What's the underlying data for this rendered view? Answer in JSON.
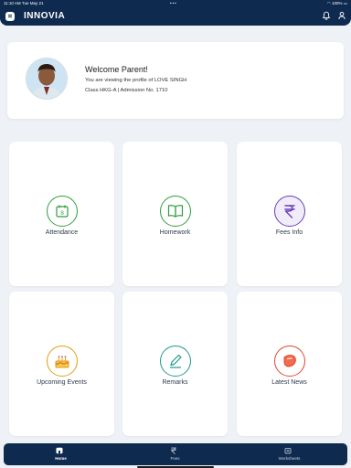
{
  "status_bar": {
    "time": "11:10 AM",
    "date": "Tue May 21",
    "dots": "•••",
    "battery": "100%"
  },
  "header": {
    "title": "INNOVIA",
    "menu_icon": "menu-icon",
    "bell_icon": "bell-icon",
    "user_icon": "user-icon"
  },
  "profile": {
    "welcome": "Welcome Parent!",
    "viewing": "You are viewing the profile of LOVE SINGH",
    "class_info": "Class HKG-A | Admission No. 1710"
  },
  "tiles": [
    {
      "label": "Attendance",
      "icon": "calendar-icon",
      "color": "#2e9e3e"
    },
    {
      "label": "Homework",
      "icon": "book-icon",
      "color": "#2e9e3e"
    },
    {
      "label": "Fees Info",
      "icon": "rupee-icon",
      "color": "#6a3fb5"
    },
    {
      "label": "Upcoming Events",
      "icon": "cake-icon",
      "color": "#e0a010"
    },
    {
      "label": "Remarks",
      "icon": "pen-icon",
      "color": "#1f9a8a"
    },
    {
      "label": "Latest News",
      "icon": "news-icon",
      "color": "#e0462e"
    }
  ],
  "bottom_nav": [
    {
      "label": "Home",
      "icon": "home-icon",
      "active": true
    },
    {
      "label": "Fees",
      "icon": "rupee-icon",
      "active": false
    },
    {
      "label": "Worksheets",
      "icon": "worksheet-icon",
      "active": false
    }
  ],
  "colors": {
    "primary": "#0f2a4f",
    "background": "#eef1f6"
  }
}
